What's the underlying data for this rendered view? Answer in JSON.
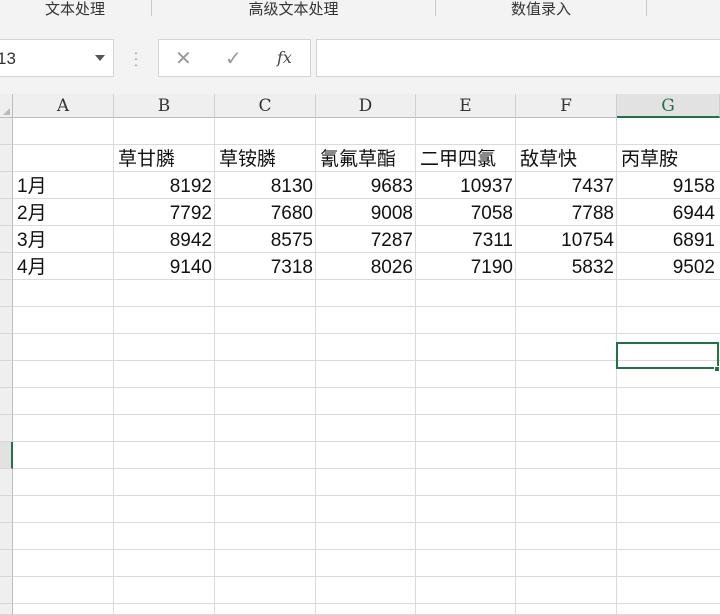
{
  "ribbon": {
    "groups": [
      "文本处理",
      "高级文本处理",
      "数值录入"
    ]
  },
  "formula_bar": {
    "name_box": "13",
    "cancel_glyph": "✕",
    "enter_glyph": "✓",
    "fx_label": "fx",
    "formula": ""
  },
  "columns": [
    "A",
    "B",
    "C",
    "D",
    "E",
    "F",
    "G"
  ],
  "active_column": "G",
  "sheet": {
    "headers": [
      "",
      "草甘膦",
      "草铵膦",
      "氰氟草酯",
      "二甲四氯",
      "敌草快",
      "丙草胺"
    ],
    "rows": [
      [
        "1月",
        "8192",
        "8130",
        "9683",
        "10937",
        "7437",
        "9158"
      ],
      [
        "2月",
        "7792",
        "7680",
        "9008",
        "7058",
        "7788",
        "6944"
      ],
      [
        "3月",
        "8942",
        "8575",
        "7287",
        "7311",
        "10754",
        "6891"
      ],
      [
        "4月",
        "9140",
        "7318",
        "8026",
        "7190",
        "5832",
        "9502"
      ]
    ]
  },
  "colors": {
    "accent": "#217346",
    "gridline": "#dadada",
    "header_bg": "#efefef"
  }
}
